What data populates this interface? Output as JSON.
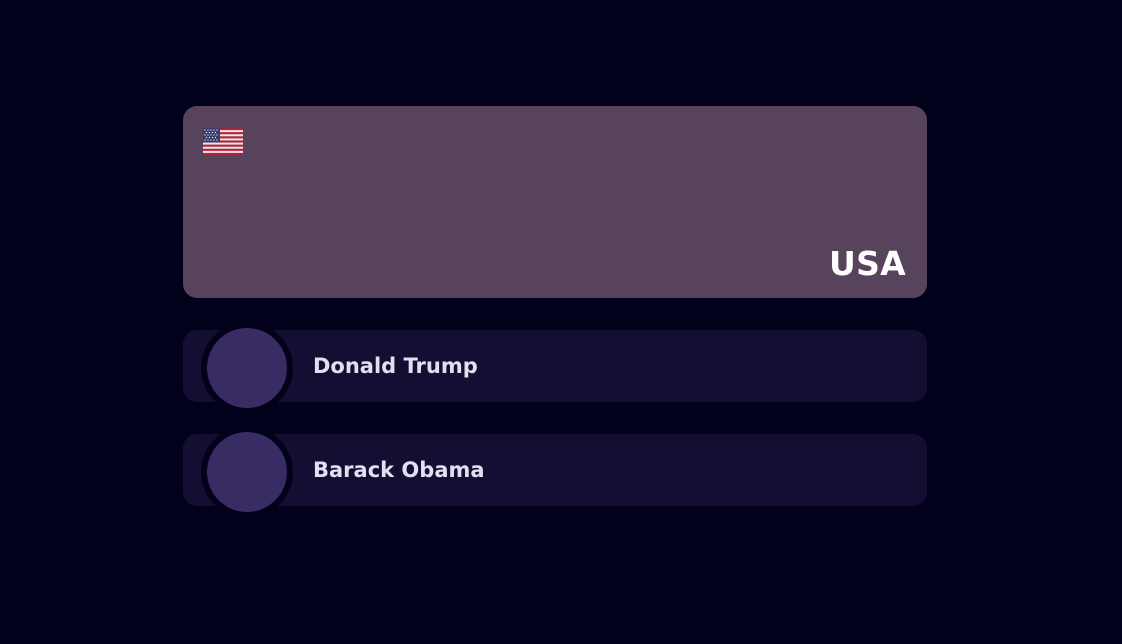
{
  "country": {
    "name": "USA",
    "flag_icon": "us-flag-icon",
    "card_color": "#57435c"
  },
  "people": [
    {
      "name": "Donald Trump"
    },
    {
      "name": "Barack Obama"
    }
  ],
  "colors": {
    "background": "#01011c",
    "row": "#140f32",
    "avatar": "#382c62"
  }
}
